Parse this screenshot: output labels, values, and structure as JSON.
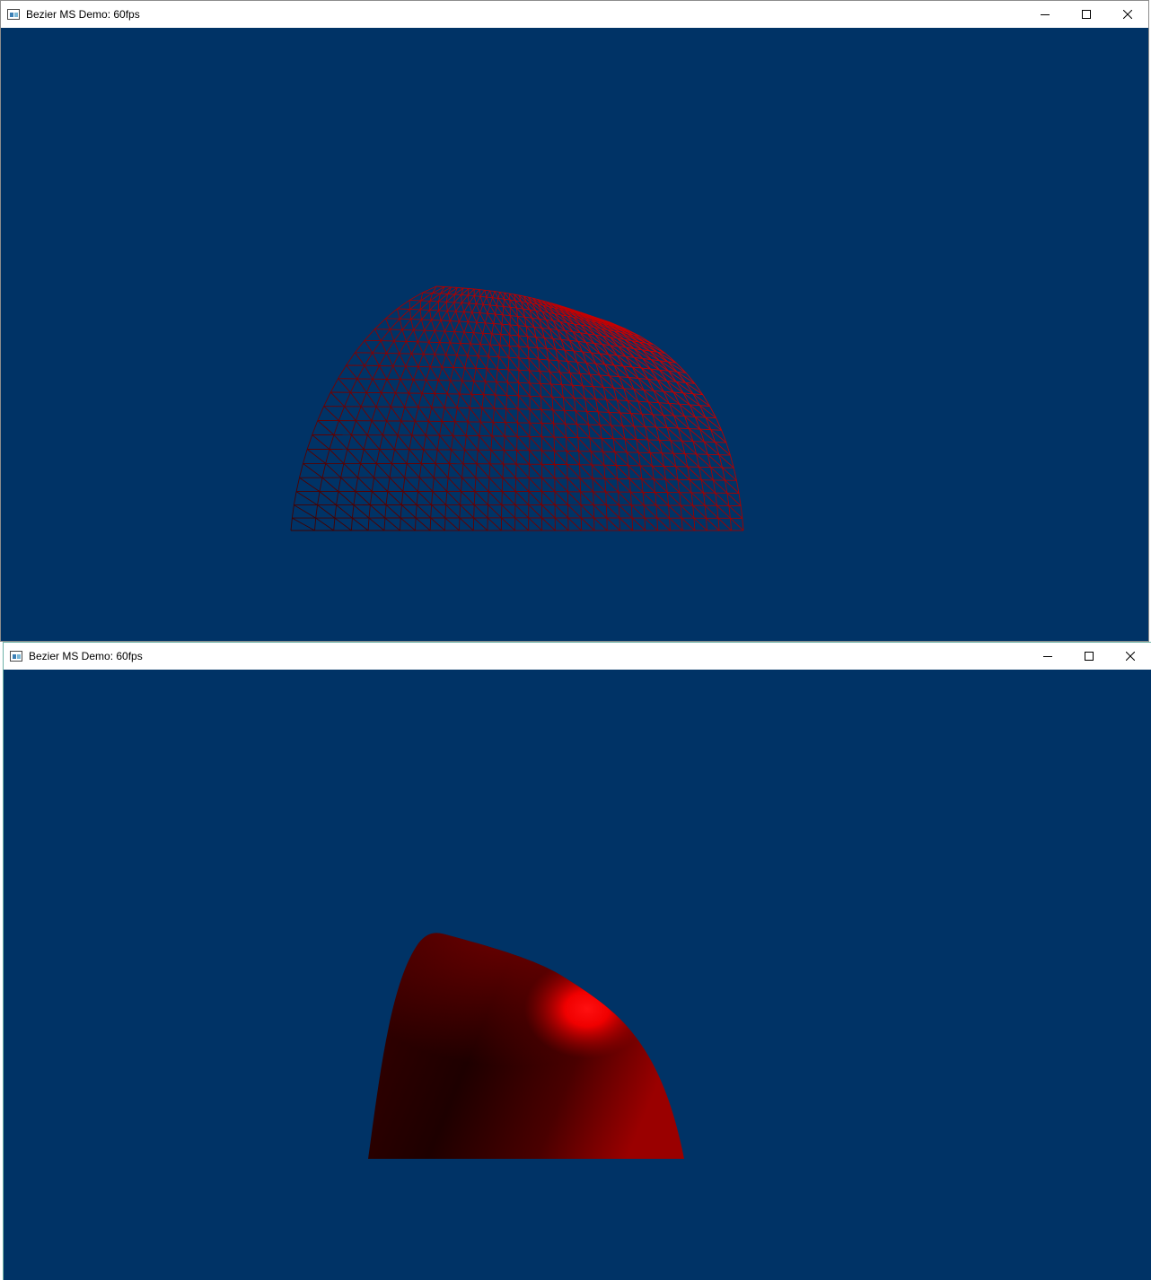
{
  "windows": [
    {
      "title": "Bezier MS Demo: 60fps",
      "mode": "wireframe",
      "buttons": {
        "minimize": "minimize-icon",
        "maximize": "maximize-icon",
        "close": "close-icon"
      }
    },
    {
      "title": "Bezier MS Demo: 60fps",
      "mode": "solid",
      "buttons": {
        "minimize": "minimize-icon",
        "maximize": "maximize-icon",
        "close": "close-icon"
      }
    }
  ],
  "colors": {
    "viewport_background": "#003366",
    "surface_color": "#ff0000",
    "surface_shadow": "#1e0000"
  }
}
